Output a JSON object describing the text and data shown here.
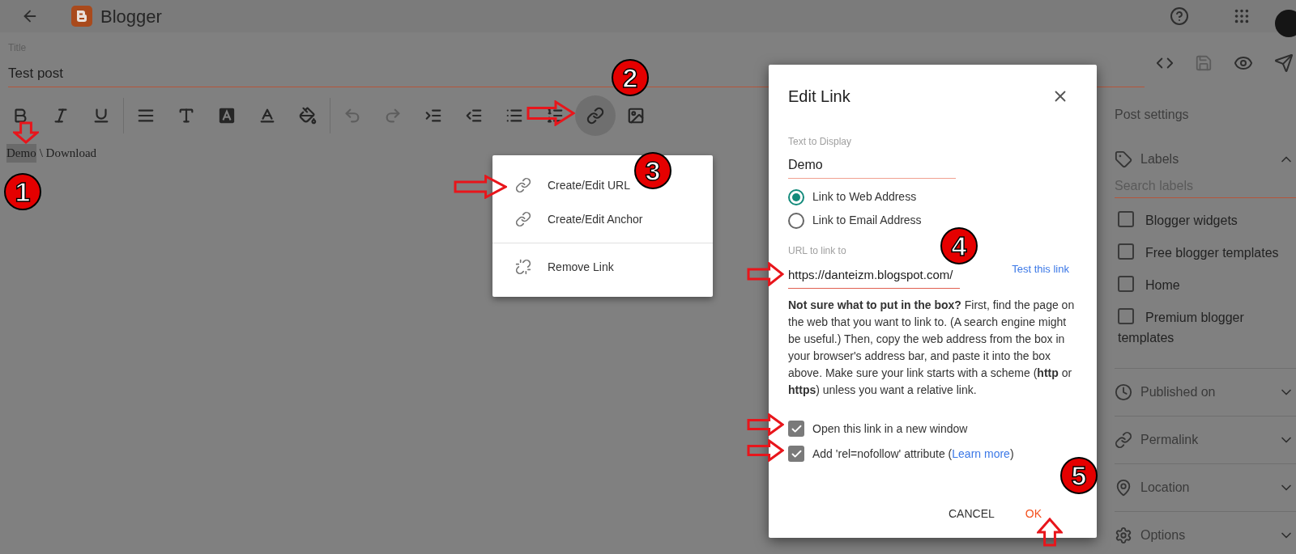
{
  "app": {
    "title": "Blogger"
  },
  "post": {
    "title_label": "Title",
    "title": "Test post",
    "body": [
      {
        "text": "Demo",
        "selected": true
      },
      {
        "text": "\\ Download",
        "selected": false
      }
    ]
  },
  "toolbar": [
    {
      "kind": "bold",
      "disabled": false,
      "selected": false
    },
    {
      "kind": "italic",
      "disabled": false,
      "selected": false
    },
    {
      "kind": "underline",
      "disabled": false,
      "selected": false
    },
    {
      "kind": "divider"
    },
    {
      "kind": "align",
      "disabled": false,
      "selected": false
    },
    {
      "kind": "size",
      "disabled": false,
      "selected": false
    },
    {
      "kind": "style",
      "disabled": false,
      "selected": false
    },
    {
      "kind": "color",
      "disabled": false,
      "selected": false
    },
    {
      "kind": "highlight",
      "disabled": false,
      "selected": false
    },
    {
      "kind": "divider"
    },
    {
      "kind": "undo",
      "disabled": true,
      "selected": false
    },
    {
      "kind": "redo",
      "disabled": true,
      "selected": false
    },
    {
      "kind": "indent",
      "disabled": false,
      "selected": false
    },
    {
      "kind": "outdent",
      "disabled": false,
      "selected": false
    },
    {
      "kind": "bullets",
      "disabled": false,
      "selected": false
    },
    {
      "kind": "numbers",
      "disabled": false,
      "selected": false
    },
    {
      "kind": "link",
      "disabled": false,
      "selected": true
    },
    {
      "kind": "image",
      "disabled": false,
      "selected": false
    }
  ],
  "link_menu": {
    "groups": [
      [
        {
          "label": "Create/Edit URL",
          "kind": "link"
        },
        {
          "label": "Create/Edit Anchor",
          "kind": "link"
        }
      ],
      [
        {
          "label": "Remove Link",
          "kind": "unlink"
        }
      ]
    ]
  },
  "dialog": {
    "title": "Edit Link",
    "display_label": "Text to Display",
    "display_value": "Demo",
    "link_types": [
      {
        "label": "Link to Web Address",
        "selected": true
      },
      {
        "label": "Link to Email Address",
        "selected": false
      }
    ],
    "url_label": "URL to link to",
    "url_value": "https://danteizm.blogspot.com/",
    "test_link": "Test this link",
    "help": "**Not sure what to put in the box?** First, find the page on the web that you want to link to. (A search engine might be useful.) Then, copy the web address from the box in your browser's address bar, and paste it into the box above. Make sure your link starts with a scheme (**http** or **https**) unless you want a relative link.",
    "options": [
      {
        "label": "Open this link in a new window",
        "checked": true
      },
      {
        "label": "Add 'rel=nofollow' attribute (",
        "link": "Learn more",
        "suffix": ")",
        "checked": true
      }
    ],
    "buttons": [
      {
        "label": "CANCEL",
        "kind": "cancel"
      },
      {
        "label": "OK",
        "kind": "ok"
      }
    ]
  },
  "sidebar": {
    "title": "Post settings",
    "sections": [
      {
        "kind": "labels",
        "title": "Labels",
        "expanded": true,
        "search_placeholder": "Search labels",
        "labels": [
          {
            "label": "Blogger widgets",
            "checked": false
          },
          {
            "label": "Free blogger templates",
            "checked": false
          },
          {
            "label": "Home",
            "checked": false
          },
          {
            "label": "Premium blogger templates",
            "checked": false
          }
        ]
      },
      {
        "kind": "published",
        "title": "Published on",
        "expanded": false
      },
      {
        "kind": "permalink",
        "title": "Permalink",
        "expanded": false
      },
      {
        "kind": "location",
        "title": "Location",
        "expanded": false
      },
      {
        "kind": "options",
        "title": "Options",
        "expanded": false
      }
    ]
  },
  "annotations": [
    {
      "number": "1"
    },
    {
      "number": "2"
    },
    {
      "number": "3"
    },
    {
      "number": "4"
    },
    {
      "number": "5"
    }
  ]
}
